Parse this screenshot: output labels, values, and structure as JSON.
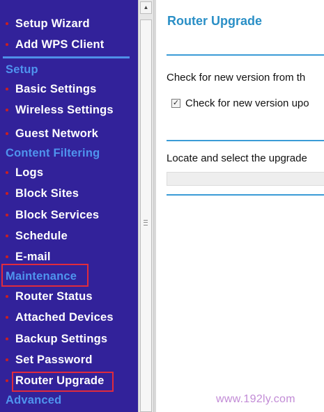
{
  "nav": {
    "top_items": [
      {
        "label": "Setup Wizard"
      },
      {
        "label": "Add WPS Client"
      }
    ],
    "setup": {
      "heading": "Setup",
      "items": [
        {
          "label": "Basic Settings"
        },
        {
          "label": "Wireless Settings"
        },
        {
          "label": "Guest Network"
        }
      ]
    },
    "content_filtering": {
      "heading": "Content Filtering",
      "items": [
        {
          "label": "Logs"
        },
        {
          "label": "Block Sites"
        },
        {
          "label": "Block Services"
        },
        {
          "label": "Schedule"
        },
        {
          "label": "E-mail"
        }
      ]
    },
    "maintenance": {
      "heading": "Maintenance",
      "items": [
        {
          "label": "Router Status"
        },
        {
          "label": "Attached Devices"
        },
        {
          "label": "Backup Settings"
        },
        {
          "label": "Set Password"
        },
        {
          "label": "Router Upgrade"
        }
      ]
    },
    "advanced": {
      "heading": "Advanced"
    }
  },
  "main": {
    "title": "Router Upgrade",
    "check_online_text": "Check for new version from th",
    "checkbox": {
      "label": "Check for new version upo",
      "checked": true
    },
    "locate_text": "Locate and select the upgrade"
  },
  "watermark": "www.192ly.com",
  "colors": {
    "sidebar_bg": "#32229a",
    "heading_blue": "#4f94ee",
    "title_blue": "#2a8fc6",
    "highlight_red": "#e12b3c"
  }
}
